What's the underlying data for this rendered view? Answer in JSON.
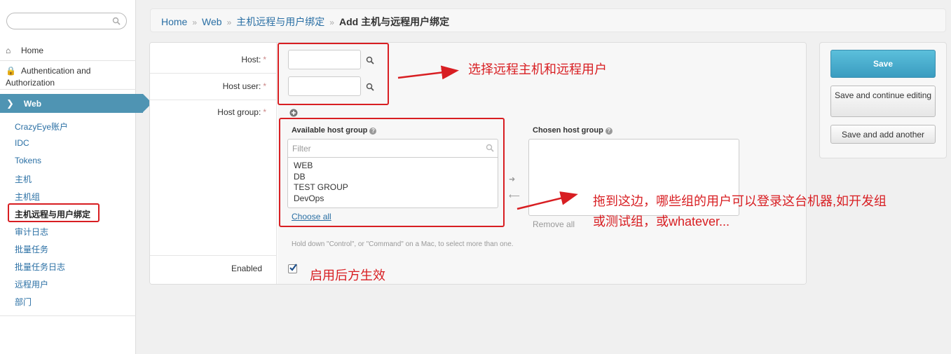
{
  "sidebar": {
    "search": {
      "value": "",
      "placeholder": ""
    },
    "top_items": [
      {
        "label": "Home",
        "icon": "home-icon"
      },
      {
        "label": "Authentication and Authorization",
        "icon": "lock-icon"
      }
    ],
    "active_section": "Web",
    "sub_items": [
      {
        "label": "CrazyEye账户"
      },
      {
        "label": "IDC"
      },
      {
        "label": "Tokens"
      },
      {
        "label": "主机"
      },
      {
        "label": "主机组"
      },
      {
        "label": "主机远程与用户绑定",
        "active": true
      },
      {
        "label": "审计日志"
      },
      {
        "label": "批量任务"
      },
      {
        "label": "批量任务日志"
      },
      {
        "label": "远程用户"
      },
      {
        "label": "部门"
      }
    ]
  },
  "breadcrumb": {
    "items": [
      "Home",
      "Web",
      "主机远程与用户绑定"
    ],
    "separator": "»",
    "current": "Add 主机与远程用户绑定"
  },
  "form": {
    "host_label": "Host:",
    "host_user_label": "Host user:",
    "host_group_label": "Host group:",
    "required_mark": "*",
    "enabled_label": "Enabled",
    "enabled_checked": true,
    "available_title": "Available host group",
    "chosen_title": "Chosen host group",
    "filter_placeholder": "Filter",
    "available_options": [
      "WEB",
      "DB",
      "TEST GROUP",
      "DevOps"
    ],
    "choose_all": "Choose all",
    "remove_all": "Remove all",
    "help_text": "Hold down \"Control\", or \"Command\" on a Mac, to select more than one."
  },
  "annotations": {
    "select_host_user": "选择远程主机和远程用户",
    "drag_here_line1": "拖到这边，哪些组的用户可以登录这台机器,如开发组",
    "drag_here_line2": "或测试组，或whatever...",
    "enable_note": "启用后方生效",
    "color": "#d81e22"
  },
  "submit": {
    "save": "Save",
    "save_continue": "Save and continue editing",
    "save_another": "Save and add another"
  },
  "colors": {
    "accent": "#4f94b3",
    "link": "#2a6fa4",
    "save_button": "#3a9cc0"
  }
}
